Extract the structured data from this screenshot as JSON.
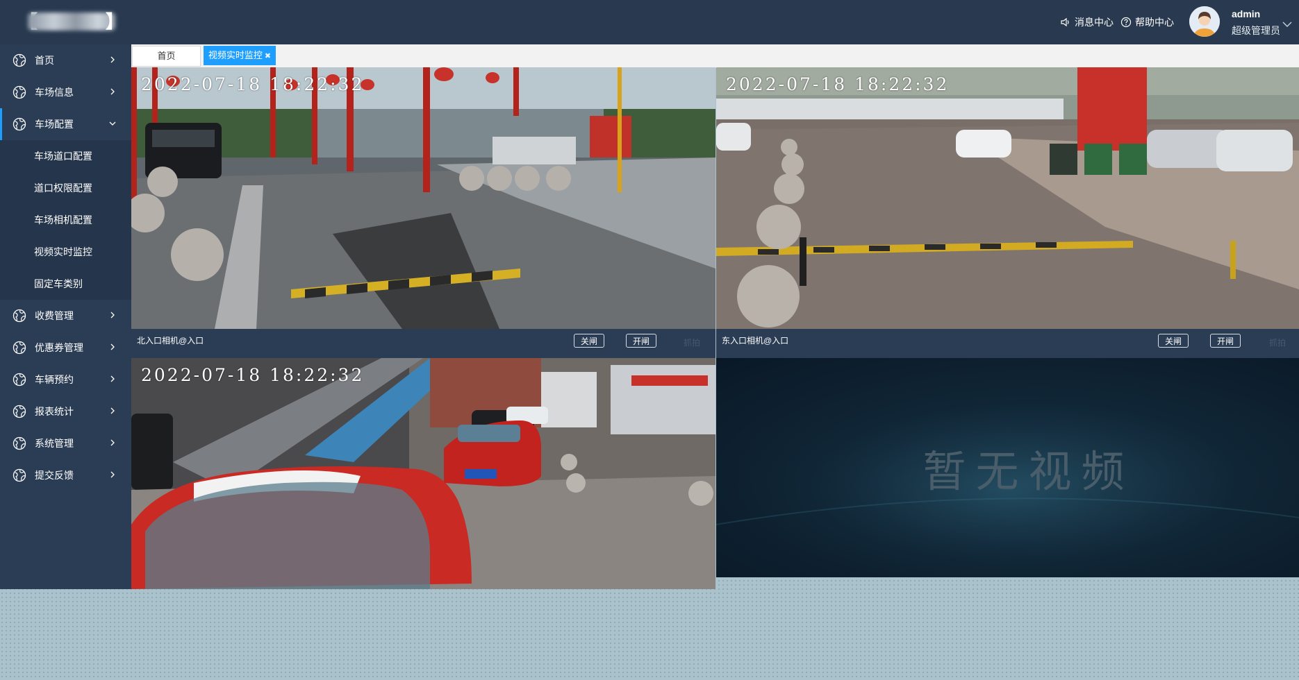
{
  "header": {
    "logo_left_bracket": "【",
    "logo_right_bracket": "】",
    "messages_label": "消息中心",
    "help_label": "帮助中心",
    "user_name": "admin",
    "user_role": "超级管理员"
  },
  "sidebar": {
    "items": [
      {
        "label": "首页",
        "icon": "globe-icon"
      },
      {
        "label": "车场信息",
        "icon": "globe-icon"
      },
      {
        "label": "车场配置",
        "icon": "globe-icon",
        "expanded": true
      },
      {
        "label": "收费管理",
        "icon": "globe-icon"
      },
      {
        "label": "优惠券管理",
        "icon": "globe-icon"
      },
      {
        "label": "车辆预约",
        "icon": "globe-icon"
      },
      {
        "label": "报表统计",
        "icon": "globe-icon"
      },
      {
        "label": "系统管理",
        "icon": "globe-icon"
      },
      {
        "label": "提交反馈",
        "icon": "globe-icon"
      }
    ],
    "subitems": [
      "车场道口配置",
      "道口权限配置",
      "车场相机配置",
      "视频实时监控",
      "固定车类别"
    ]
  },
  "tabs": {
    "home": "首页",
    "active": "视频实时监控",
    "close_icon": "✖"
  },
  "videos": [
    {
      "timestamp": "2022-07-18 18:22:32",
      "camera_name": "北入口相机@入口",
      "close_label": "关闸",
      "open_label": "开闸",
      "extra_label": "抓拍"
    },
    {
      "timestamp": "2022-07-18 18:22:32",
      "camera_name": "东入口相机@入口",
      "close_label": "关闸",
      "open_label": "开闸",
      "extra_label": "抓拍"
    },
    {
      "timestamp": "2022-07-18 18:22:32"
    },
    {
      "no_video_text": "暂无视频"
    }
  ],
  "colors": {
    "header_bg": "#293a50",
    "sidebar_bg": "#2b3d55",
    "accent": "#1e9fff"
  }
}
